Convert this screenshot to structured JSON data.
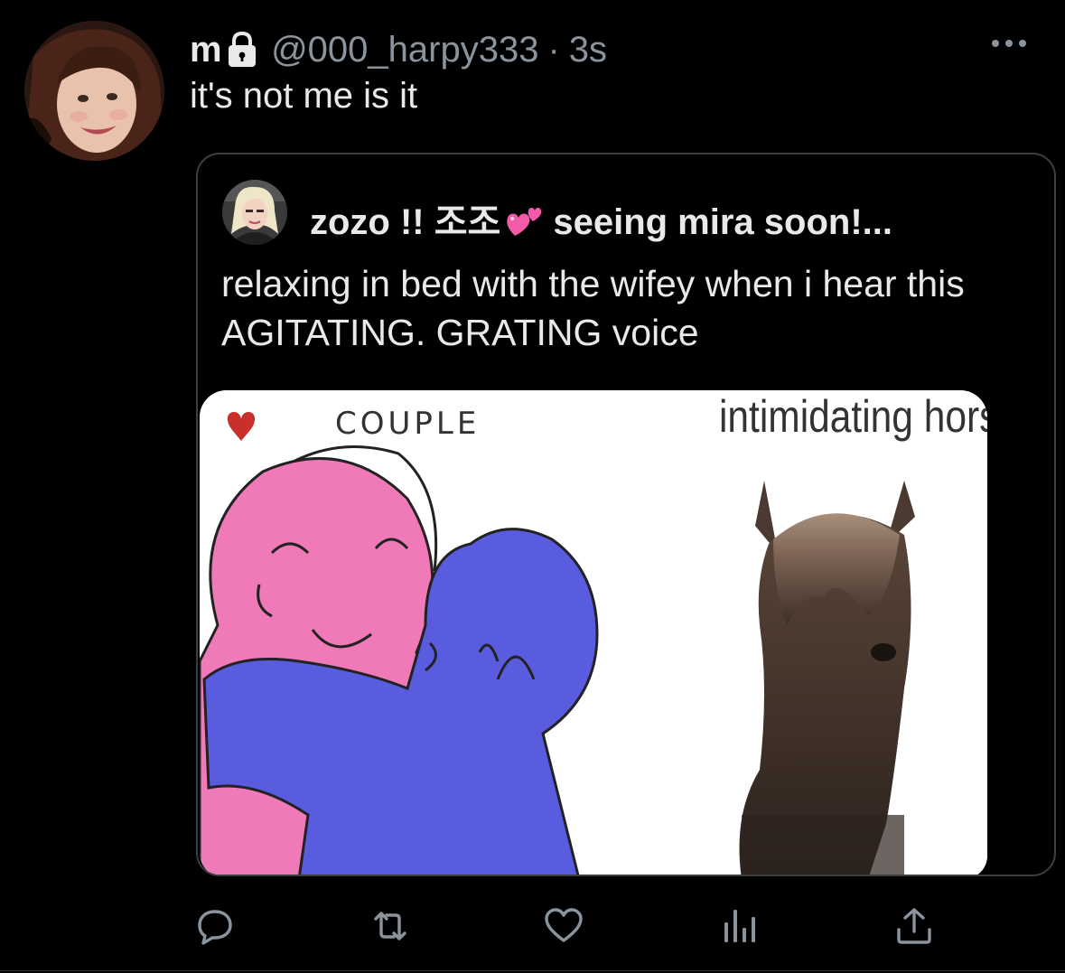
{
  "tweet": {
    "display_name": "m",
    "handle": "@000_harpy333",
    "separator": "·",
    "timestamp": "3s",
    "text": "it's not me is it",
    "lock_icon": "lock-icon",
    "more_icon": "more-horizontal-icon"
  },
  "quote": {
    "display_name_before_emoji": "zozo !! 조조",
    "emoji": "two-hearts-emoji",
    "display_name_after_emoji": "seeing mira soon!...",
    "text": "relaxing in bed with the wifey when i hear this AGITATING. GRATING voice",
    "media": {
      "caption_left": "COUPLE",
      "caption_right": "intimidating horse"
    }
  },
  "actions": [
    {
      "name": "reply",
      "icon": "reply-icon"
    },
    {
      "name": "retweet",
      "icon": "retweet-icon"
    },
    {
      "name": "like",
      "icon": "heart-icon"
    },
    {
      "name": "analytics",
      "icon": "analytics-icon"
    },
    {
      "name": "share",
      "icon": "share-icon"
    }
  ],
  "colors": {
    "background": "#000000",
    "text_primary": "#e7e9ea",
    "text_secondary": "#8b949c",
    "border": "#3a3f44",
    "couple_pink": "#f07ab8",
    "couple_blue": "#5a5ce0",
    "heart_red": "#c9302c"
  }
}
